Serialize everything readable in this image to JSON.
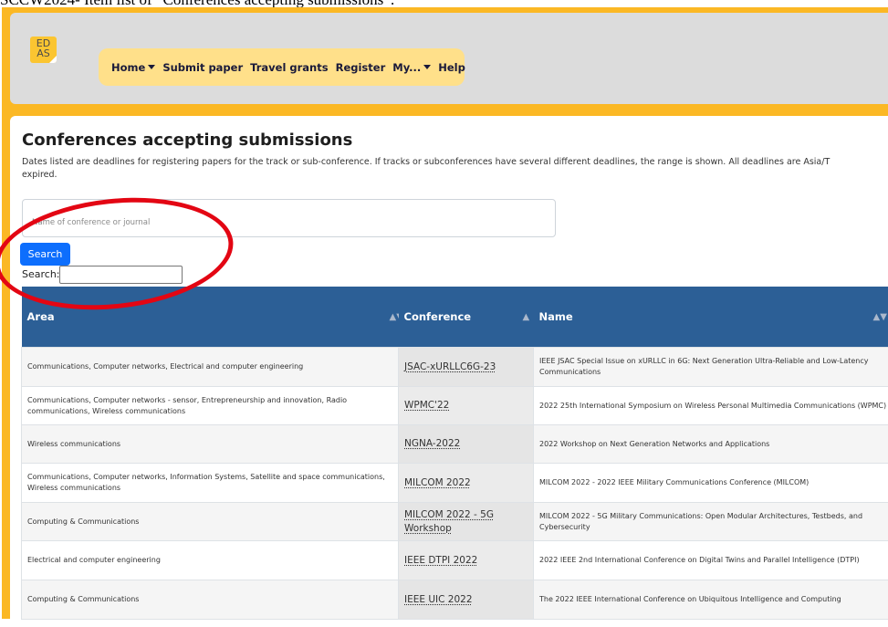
{
  "caption": "SCCW2024- Item list of “Conferences accepting submissions”:",
  "logo": {
    "text": "ED\nAS"
  },
  "nav": {
    "home": "Home",
    "submit_paper": "Submit paper",
    "travel_grants": "Travel grants",
    "register": "Register",
    "my": "My...",
    "help": "Help"
  },
  "page": {
    "title": "Conferences accepting submissions",
    "intro_line1": "Dates listed are deadlines for registering papers for the track or sub-conference. If tracks or subconferences have several different deadlines, the range is shown. All deadlines are Asia/T",
    "intro_line2": "expired."
  },
  "search": {
    "placeholder": "Name of conference or journal",
    "button_label": "Search",
    "filter_label": "Search:"
  },
  "annotation": {
    "color": "#e30613"
  },
  "colors": {
    "frame": "#fbb824",
    "table_header": "#2c5f96",
    "primary": "#0d6efd"
  },
  "table": {
    "columns": {
      "area": "Area",
      "conference": "Conference",
      "name": "Name"
    },
    "rows": [
      {
        "area": "Communications, Computer networks, Electrical and computer engineering",
        "conference": "JSAC-xURLLC6G-23",
        "name": "IEEE JSAC Special Issue on xURLLC in 6G: Next Generation Ultra-Reliable and Low-Latency Communications"
      },
      {
        "area": "Communications, Computer networks - sensor, Entrepreneurship and innovation, Radio communications, Wireless communications",
        "conference": "WPMC'22",
        "name": "2022 25th International Symposium on Wireless Personal Multimedia Communications (WPMC)"
      },
      {
        "area": "Wireless communications",
        "conference": "NGNA-2022",
        "name": "2022 Workshop on Next Generation Networks and Applications"
      },
      {
        "area": "Communications, Computer networks, Information Systems, Satellite and space communications, Wireless communications",
        "conference": "MILCOM 2022",
        "name": "MILCOM 2022 - 2022 IEEE Military Communications Conference (MILCOM)"
      },
      {
        "area": "Computing & Communications",
        "conference": "MILCOM 2022 - 5G Workshop",
        "name": "MILCOM 2022 - 5G Military Communications: Open Modular Architectures, Testbeds, and Cybersecurity"
      },
      {
        "area": "Electrical and computer engineering",
        "conference": "IEEE DTPI 2022",
        "name": "2022 IEEE 2nd International Conference on Digital Twins and Parallel Intelligence (DTPI)"
      },
      {
        "area": "Computing & Communications",
        "conference": "IEEE UIC 2022",
        "name": "The 2022 IEEE International Conference on Ubiquitous Intelligence and Computing"
      }
    ]
  }
}
